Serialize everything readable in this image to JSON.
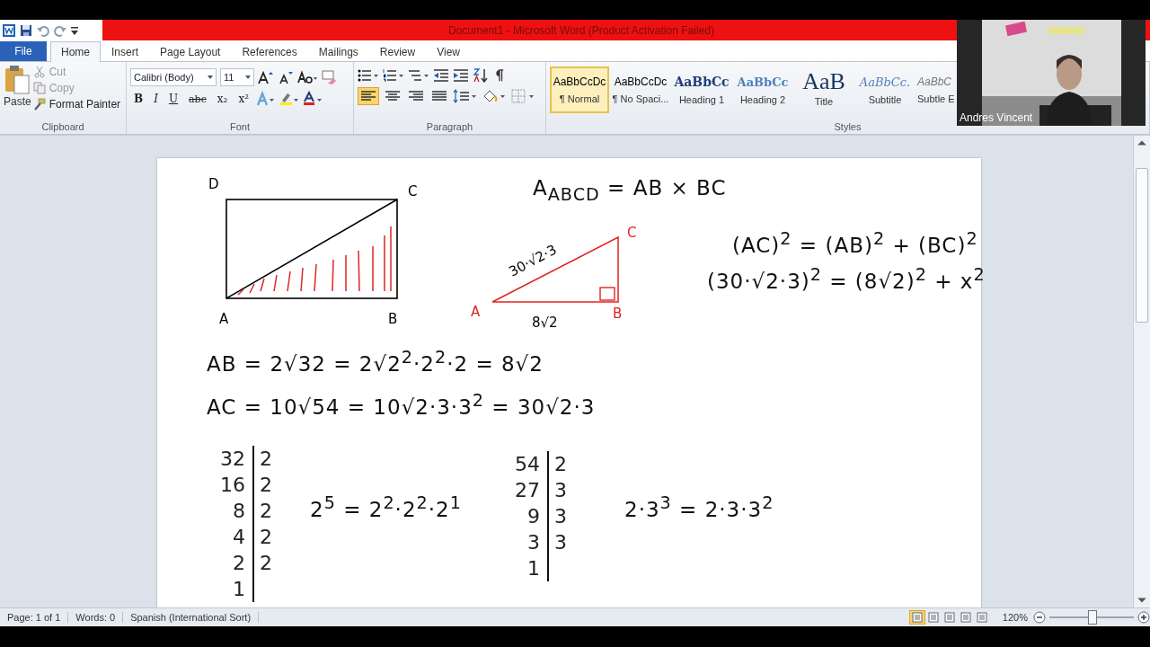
{
  "title_bar": {
    "title": "Document1 - Microsoft Word (Product Activation Failed)"
  },
  "file_tab": "File",
  "tabs": [
    {
      "label": "Home",
      "selected": true
    },
    {
      "label": "Insert",
      "selected": false
    },
    {
      "label": "Page Layout",
      "selected": false
    },
    {
      "label": "References",
      "selected": false
    },
    {
      "label": "Mailings",
      "selected": false
    },
    {
      "label": "Review",
      "selected": false
    },
    {
      "label": "View",
      "selected": false
    }
  ],
  "clipboard": {
    "paste": "Paste",
    "cut": "Cut",
    "copy": "Copy",
    "format_painter": "Format Painter",
    "label": "Clipboard"
  },
  "font": {
    "font_name": "Calibri (Body)",
    "font_size": "11",
    "format_buttons": [
      "B",
      "I",
      "U",
      "abc",
      "x₂",
      "x²"
    ],
    "label": "Font"
  },
  "paragraph": {
    "label": "Paragraph"
  },
  "styles": {
    "label": "Styles",
    "items": [
      {
        "preview": "AaBbCcDc",
        "name": "¶ Normal",
        "selected": true
      },
      {
        "preview": "AaBbCcDc",
        "name": "¶ No Spaci...",
        "selected": false
      },
      {
        "preview": "AaBbCc",
        "name": "Heading 1",
        "selected": false
      },
      {
        "preview": "AaBbCc",
        "name": "Heading 2",
        "selected": false
      },
      {
        "preview": "AaB",
        "name": "Title",
        "selected": false
      },
      {
        "preview": "AaBbCc.",
        "name": "Subtitle",
        "selected": false
      },
      {
        "preview": "AaBbC",
        "name": "Subtle E",
        "selected": false
      }
    ]
  },
  "webcam": {
    "name": "Andres Vincent"
  },
  "document": {
    "ink": [
      {
        "kind": "rectangle",
        "labels": [
          "D",
          "C",
          "A",
          "B"
        ]
      },
      {
        "kind": "equation",
        "text": "A$_{ABCD}$ = AB × BC"
      },
      {
        "kind": "triangle",
        "labels": [
          "C",
          "A",
          "B"
        ],
        "hypotenuse": "30·√2·3",
        "base": "8√2"
      },
      {
        "kind": "equation",
        "text": "(AC)$^{2}$ = (AB)$^{2}$ + (BC)$^{2}$"
      },
      {
        "kind": "equation",
        "text": "(30·√2·3)$^{2}$ = (8√2)$^{2}$ + x$^{2}$"
      },
      {
        "kind": "equation",
        "text": "AB = 2√32 = 2√2$^{2}$·2$^{2}$·2 = 8√2"
      },
      {
        "kind": "equation",
        "text": "AC = 10√54 = 10√2·3·3$^{2}$ = 30√2·3"
      },
      {
        "kind": "division",
        "rows": [
          {
            "n": "32",
            "d": "2"
          },
          {
            "n": "16",
            "d": "2"
          },
          {
            "n": "8",
            "d": "2"
          },
          {
            "n": "4",
            "d": "2"
          },
          {
            "n": "2",
            "d": "2"
          },
          {
            "n": "1"
          }
        ]
      },
      {
        "kind": "equation",
        "text": "2$^{5}$ = 2$^{2}$·2$^{2}$·2$^{1}$"
      },
      {
        "kind": "division",
        "rows": [
          {
            "n": "54",
            "d": "2"
          },
          {
            "n": "27",
            "d": "3"
          },
          {
            "n": "9",
            "d": "3"
          },
          {
            "n": "3",
            "d": "3"
          },
          {
            "n": "1"
          }
        ]
      },
      {
        "kind": "equation",
        "text": "2·3$^{3}$ = 2·3·3$^{2}$"
      }
    ]
  },
  "status_bar": {
    "page": "Page: 1 of 1",
    "words": "Words: 0",
    "language": "Spanish (International Sort)",
    "views": [
      {
        "selected": true
      },
      {
        "selected": false
      },
      {
        "selected": false
      },
      {
        "selected": false
      },
      {
        "selected": false
      }
    ],
    "zoom": "120%",
    "zoom_slider": {
      "level": 0.5
    }
  }
}
